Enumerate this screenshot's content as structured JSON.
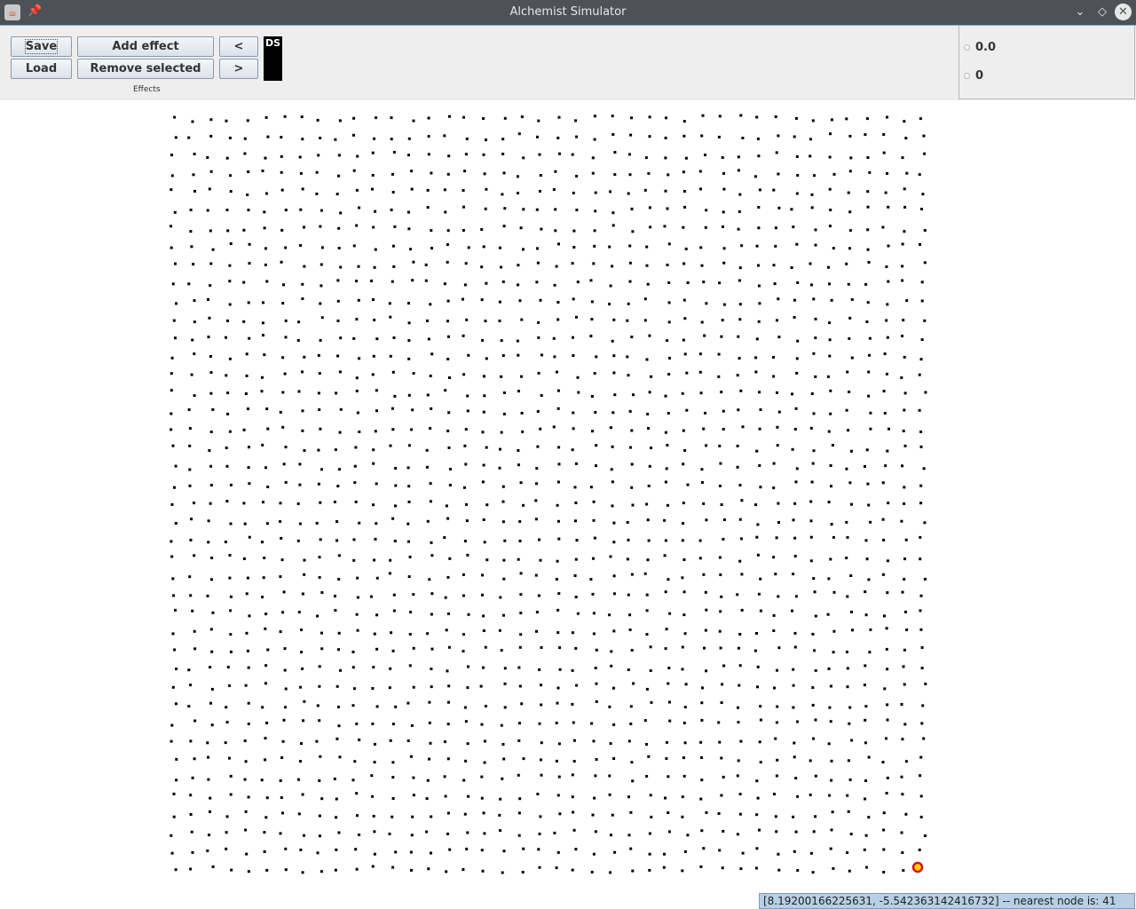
{
  "window": {
    "title": "Alchemist Simulator"
  },
  "toolbar": {
    "save_label": "Save",
    "load_label": "Load",
    "add_effect_label": "Add effect",
    "remove_selected_label": "Remove selected",
    "prev_label": "<",
    "next_label": ">",
    "effects_group_label": "Effects",
    "ds_label": "DS"
  },
  "side_panel": {
    "time_value": "0.0",
    "step_value": "0"
  },
  "status_bar": {
    "text": "[8.19200166225631, -5.542363142416732] -- nearest node is: 41"
  },
  "colors": {
    "node": "#000000",
    "selected_node_fill": "#ffd800",
    "selected_node_stroke": "#e01010"
  }
}
